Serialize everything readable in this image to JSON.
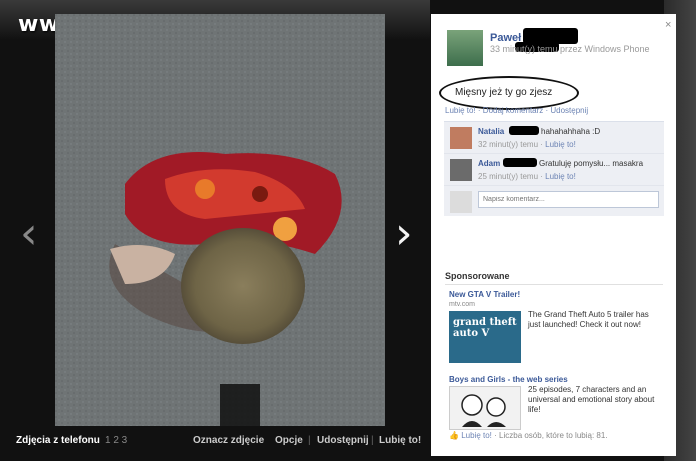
{
  "watermark": "www.wiocha.pl",
  "navigation": {
    "prev_icon": "chevron-left-icon",
    "next_icon": "chevron-right-icon"
  },
  "bottom_bar": {
    "album": "Zdjęcia z telefonu",
    "pages": "1 2 3",
    "tag_photo": "Oznacz zdjęcie",
    "options": "Opcje",
    "share": "Udostępnij",
    "like": "Lubię to!"
  },
  "post": {
    "close": "×",
    "author": "Paweł",
    "meta": "33 minut(y) temu przez Windows Phone",
    "caption": "Mięsny jeż ty go zjesz",
    "links": "Lubię to! · Dodaj komentarz · Udostępnij"
  },
  "comments": [
    {
      "name": "Natalia",
      "text": "hahahahhaha :D",
      "meta": "32 minut(y) temu · ",
      "like": "Lubię to!"
    },
    {
      "name": "Adam",
      "text": "Gratuluję pomysłu... masakra",
      "meta": "25 minut(y) temu · ",
      "like": "Lubię to!"
    }
  ],
  "comment_input": {
    "placeholder": "Napisz komentarz..."
  },
  "sponsored": {
    "heading": "Sponsorowane",
    "ads": [
      {
        "title": "New GTA V Trailer!",
        "url": "mtv.com",
        "text": "The Grand Theft Auto 5 trailer has just launched! Check it out now!",
        "image_text": "grand theft auto V"
      },
      {
        "title": "Boys and Girls - the web series",
        "url": "",
        "text": "25 episodes, 7 characters and an universal and emotional story about life!",
        "image_text": ""
      }
    ],
    "footer_like": "Lubię to!",
    "footer_count": "· Liczba osób, które to lubią: 81."
  },
  "colors": {
    "link": "#3b5998",
    "panel": "#ffffff",
    "comment_bg": "#edeff4"
  }
}
